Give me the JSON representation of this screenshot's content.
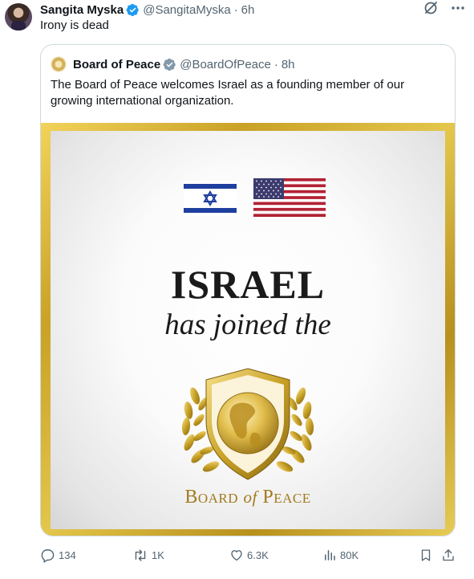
{
  "tweet": {
    "author_name": "Sangita Myska",
    "author_handle": "@SangitaMyska",
    "separator": "·",
    "time": "6h",
    "text": "Irony is dead"
  },
  "quote": {
    "author_name": "Board of Peace",
    "author_handle": "@BoardOfPeace",
    "separator": "·",
    "time": "8h",
    "text": "The Board of Peace welcomes Israel as a founding member of our growing international organization.",
    "image": {
      "headline": "ISRAEL",
      "subline": "has joined the",
      "logo_text_1": "Board",
      "logo_text_of": "of",
      "logo_text_2": "Peace"
    }
  },
  "actions": {
    "replies": "134",
    "reposts": "1K",
    "likes": "6.3K",
    "views": "80K"
  },
  "icons": [
    "grok-icon",
    "more-icon",
    "verified-badge-icon",
    "reply-icon",
    "repost-icon",
    "like-icon",
    "views-icon",
    "bookmark-icon",
    "share-icon"
  ],
  "colors": {
    "verified": "#1d9bf0",
    "muted": "#536471",
    "border": "#cfd9de",
    "gold": "#c9a227",
    "logo_text": "#a27a1e",
    "israel_blue": "#1f3f9f",
    "us_red": "#b22234",
    "us_blue": "#3c3b6e"
  }
}
